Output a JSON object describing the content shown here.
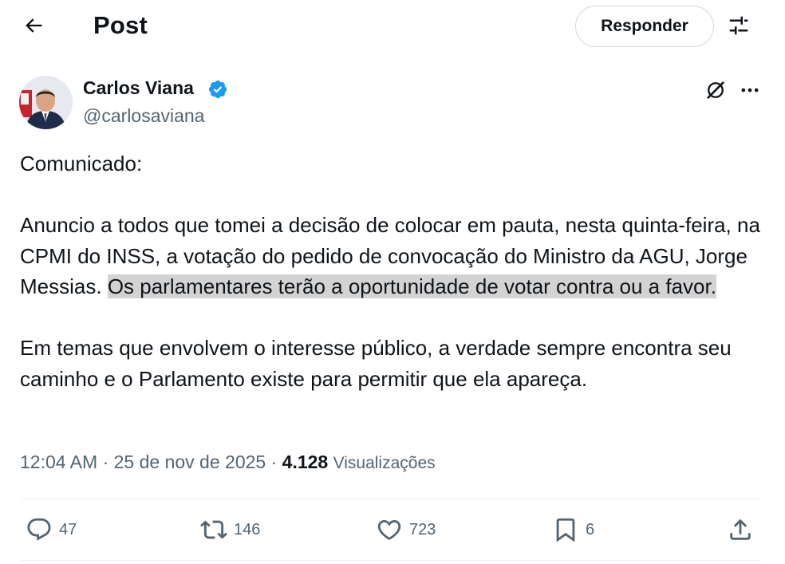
{
  "header": {
    "title": "Post",
    "reply_label": "Responder"
  },
  "author": {
    "name": "Carlos Viana",
    "handle": "@carlosaviana",
    "verified_color": "#1d9bf0"
  },
  "tweet": {
    "intro": "Comunicado:",
    "para1_plain": "Anuncio a todos que tomei a decisão de colocar em pauta, nesta quinta-feira, na CPMI do INSS, a votação do pedido de convocação do Ministro da AGU, Jorge Messias. ",
    "para1_highlight": "Os parlamentares terão a oportunidade de votar contra ou a favor.",
    "para2": "Em temas que envolvem o interesse público, a verdade sempre encontra seu caminho e o Parlamento existe para permitir que ela apareça."
  },
  "meta": {
    "time": "12:04 AM",
    "separator": " · ",
    "date": "25 de nov de 2025",
    "views_count": "4.128",
    "views_label": "Visualizações"
  },
  "actions": {
    "replies": "47",
    "reposts": "146",
    "likes": "723",
    "bookmarks": "6"
  },
  "icons": {
    "back": "arrow-left-icon",
    "filter": "sliders-icon",
    "grok": "grok-icon",
    "more": "more-dots-icon",
    "reply": "reply-bubble-icon",
    "repost": "repost-icon",
    "like": "heart-icon",
    "bookmark": "bookmark-icon",
    "share": "share-icon"
  },
  "colors": {
    "text": "#0f1419",
    "secondary": "#536471",
    "accent": "#1d9bf0",
    "highlight": "#d3d3d3",
    "border": "#cfd9de"
  }
}
